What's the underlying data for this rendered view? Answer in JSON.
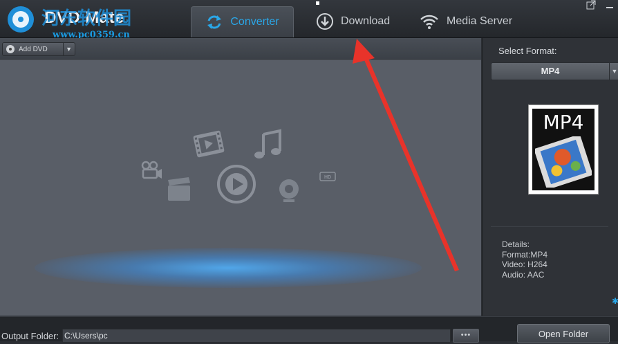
{
  "app": {
    "title": "DVD Mate",
    "watermark_cn": "河东软件园",
    "watermark_url": "www.pc0359.cn"
  },
  "tabs": [
    {
      "label": "Converter",
      "icon": "refresh-icon",
      "active": true
    },
    {
      "label": "Download",
      "icon": "download-icon",
      "active": false
    },
    {
      "label": "Media Server",
      "icon": "wifi-icon",
      "active": false
    }
  ],
  "toolbar": {
    "add_dvd_label": "Add DVD"
  },
  "format_panel": {
    "select_label": "Select Format:",
    "selected_format": "MP4",
    "thumbnail_label": "MP4",
    "details_label": "Details:",
    "format_line": "Format:MP4",
    "video_line": "Video: H264",
    "audio_line": "Audio: AAC"
  },
  "output": {
    "label": "Output Folder:",
    "path": "C:\\Users\\pc",
    "browse_label": "•••",
    "open_folder_label": "Open Folder"
  },
  "colors": {
    "accent": "#2aa7e8",
    "annotation_arrow": "#e8332a"
  }
}
